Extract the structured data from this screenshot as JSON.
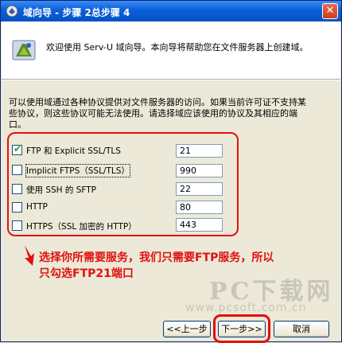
{
  "window": {
    "title": "域向导 - 步骤 2总步骤 4",
    "close_symbol": "✕"
  },
  "header": {
    "text": "欢迎使用 Serv-U 域向导。本向导将帮助您在文件服务器上创建域。"
  },
  "description": {
    "lines": [
      "可以使用域通过各种协议提供对文件服务器的访问。如果当前许可证不支持某",
      "些协议，则这些协议可能无法使用。请选择域应该使用的协议及其相应的端",
      "口。"
    ]
  },
  "protocols": [
    {
      "label": "FTP 和 Explicit SSL/TLS",
      "checked": true,
      "port": "21"
    },
    {
      "label": "Implicit FTPS（SSL/TLS）",
      "checked": false,
      "port": "990"
    },
    {
      "label": "使用 SSH 的 SFTP",
      "checked": false,
      "port": "22"
    },
    {
      "label": "HTTP",
      "checked": false,
      "port": "80"
    },
    {
      "label": "HTTPS（SSL 加密的 HTTP）",
      "checked": false,
      "port": "443"
    }
  ],
  "annotation": {
    "lines": [
      "选择你所需要服务，我们只需要FTP服务，所以",
      "只勾选FTP21端口"
    ]
  },
  "watermark": {
    "line1": "PC下载网",
    "line2": "www.pcsoft.com.cn"
  },
  "buttons": {
    "back": "<<上一步",
    "next": "下一步>>",
    "cancel": "取消"
  },
  "colors": {
    "annotation_red": "#e0110f",
    "titlebar_blue": "#0a5fd8"
  }
}
